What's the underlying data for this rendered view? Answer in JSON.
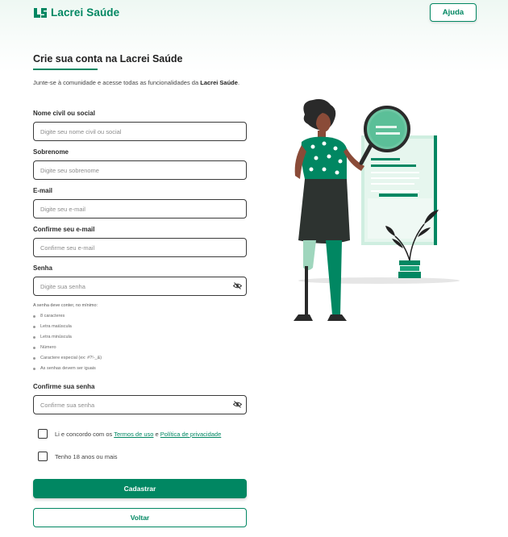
{
  "header": {
    "brand_name": "Lacrei Saúde",
    "help_label": "Ajuda",
    "brand_color": "#018762"
  },
  "form": {
    "title": "Crie sua conta na Lacrei Saúde",
    "intro_text": "Junte-se à comunidade e acesse todas as funcionalidades da ",
    "intro_brand": "Lacrei Saúde",
    "intro_end": ".",
    "fields": {
      "name": {
        "label": "Nome civil ou social",
        "placeholder": "Digite seu nome civil ou social"
      },
      "surname": {
        "label": "Sobrenome",
        "placeholder": "Digite seu sobrenome"
      },
      "email": {
        "label": "E-mail",
        "placeholder": "Digite seu e-mail"
      },
      "email_confirm": {
        "label": "Confirme seu e-mail",
        "placeholder": "Confirme seu e-mail"
      },
      "password": {
        "label": "Senha",
        "placeholder": "Digite sua senha"
      },
      "password_confirm": {
        "label": "Confirme sua senha",
        "placeholder": "Confirme sua senha"
      }
    },
    "password_rules": {
      "title": "A senha deve conter, no mínimo:",
      "items": [
        "8 caracteres",
        "Letra maiúscula",
        "Letra minúscula",
        "Número",
        "Caractere especial   (ex: #?!-_&)",
        "As senhas devem ser iguais"
      ]
    },
    "terms": {
      "prefix": "Li e concordo com os ",
      "terms_link": "Termos de uso",
      "middle": " e ",
      "privacy_link": "Política de privacidade"
    },
    "age_label": "Tenho 18 anos ou mais",
    "submit_label": "Cadastrar",
    "back_label": "Voltar"
  },
  "icons": {
    "password_toggle": "eye-slash-icon",
    "logo": "lacrei-logo-icon"
  }
}
